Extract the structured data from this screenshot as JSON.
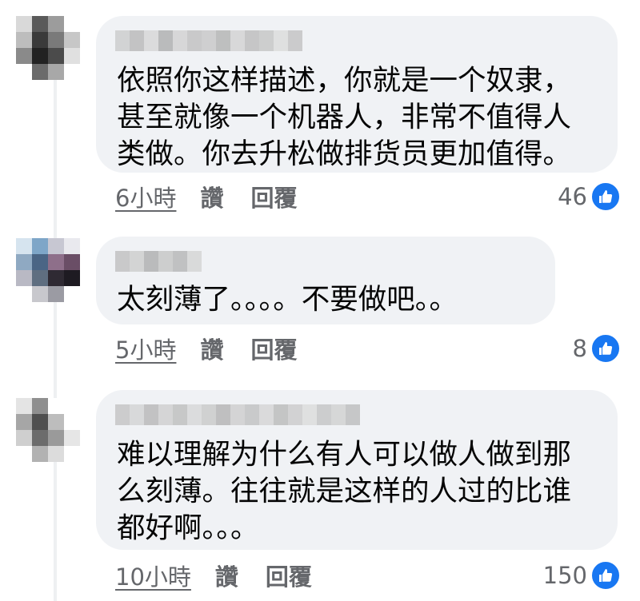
{
  "comments": [
    {
      "text_lines": [
        "依照你这样描述，你就是一个奴隶，",
        "甚至就像一个机器人，非常不值得人",
        "类做。你去升松做排货员更加值得。"
      ],
      "time": "6小時",
      "like_label": "讚",
      "reply_label": "回覆",
      "reaction_count": "46",
      "reaction_icon": "like-icon"
    },
    {
      "text_lines": [
        "太刻薄了。。。。不要做吧。。"
      ],
      "time": "5小時",
      "like_label": "讚",
      "reply_label": "回覆",
      "reaction_count": "8",
      "reaction_icon": "like-icon"
    },
    {
      "text_lines": [
        "难以理解为什么有人可以做人做到那",
        "么刻薄。往往就是这样的人过的比谁",
        "都好啊。。。"
      ],
      "time": "10小時",
      "like_label": "讚",
      "reply_label": "回覆",
      "reaction_count": "150",
      "reaction_icon": "like-icon"
    }
  ],
  "colors": {
    "bubble": "#f0f2f5",
    "text": "#050505",
    "meta_text": "#65676b",
    "like_blue": "#1877f2"
  }
}
